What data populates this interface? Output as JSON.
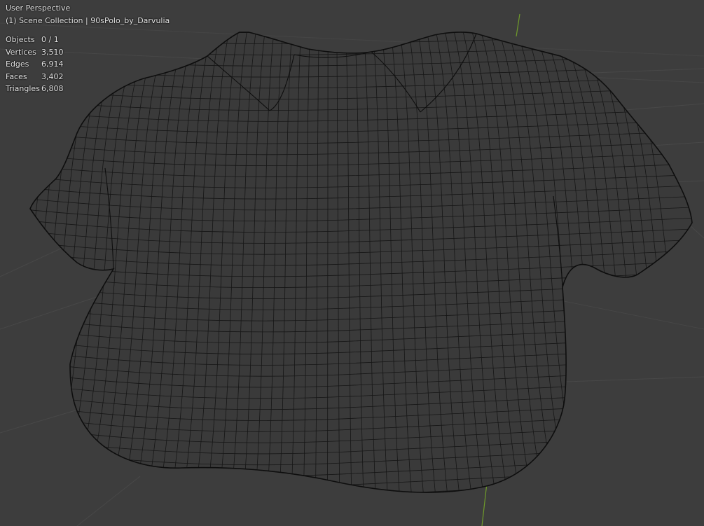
{
  "viewport": {
    "view_name": "User Perspective",
    "collection_line": "(1) Scene Collection | 90sPolo_by_Darvulia",
    "background_color": "#3d3d3d",
    "grid_color": "#4a4a4a",
    "mesh_wire_color": "#111111",
    "y_axis_color": "#6f9b2a"
  },
  "stats": [
    {
      "label": "Objects",
      "value": "0 / 1"
    },
    {
      "label": "Vertices",
      "value": "3,510"
    },
    {
      "label": "Edges",
      "value": "6,914"
    },
    {
      "label": "Faces",
      "value": "3,402"
    },
    {
      "label": "Triangles",
      "value": "6,808"
    }
  ]
}
